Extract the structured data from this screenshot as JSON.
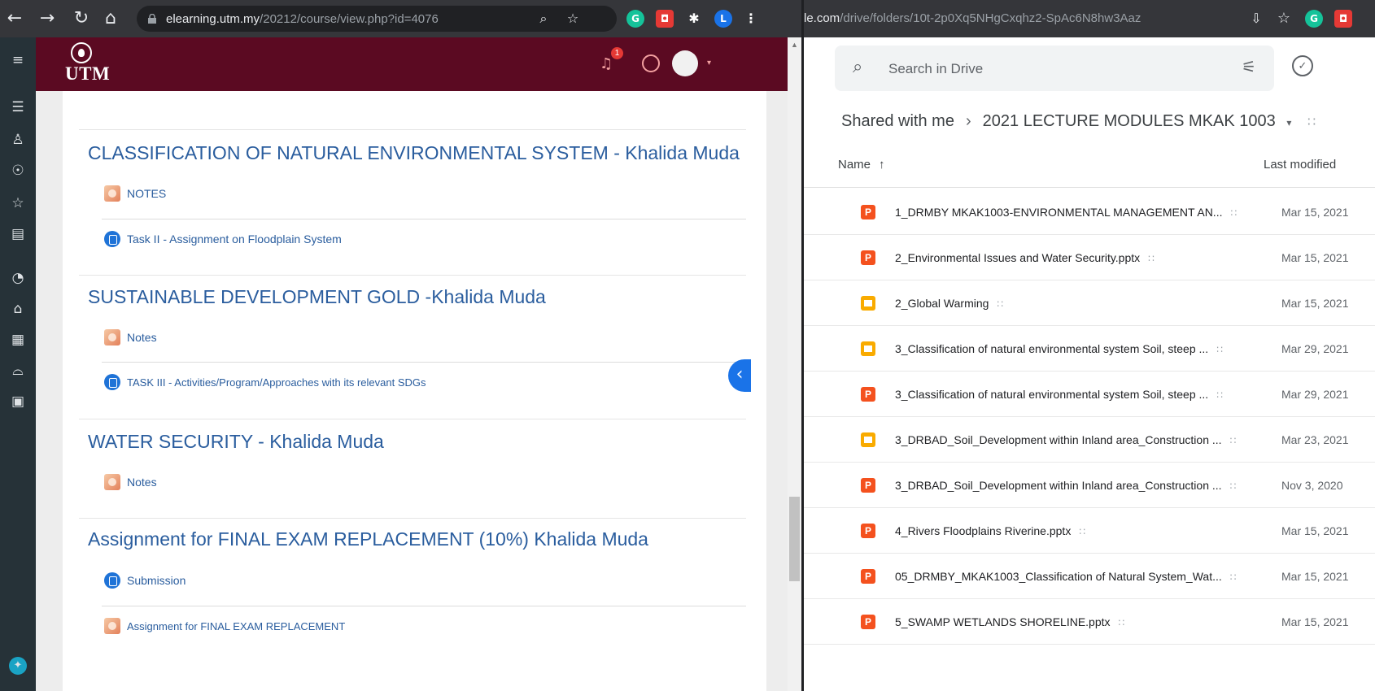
{
  "browser_left": {
    "url_host": "elearning.utm.my",
    "url_path": "/20212/course/view.php?id=4076",
    "profile_letter": "L",
    "ext_g": "G"
  },
  "browser_right": {
    "url_host": "le.com",
    "url_path": "/drive/folders/10t-2p0Xq5NHgCxqhz2-SpAc6N8hw3Aaz",
    "ext_g": "G"
  },
  "moodle": {
    "logo_text": "UTM",
    "notification_count": "1",
    "sections": [
      {
        "title": "CLASSIFICATION OF NATURAL ENVIRONMENTAL SYSTEM - Khalida Muda",
        "activities": [
          {
            "type": "resource",
            "label": "NOTES"
          },
          {
            "type": "assignment",
            "label": "Task II - Assignment on Floodplain System"
          }
        ]
      },
      {
        "title": "SUSTAINABLE DEVELOPMENT GOLD -Khalida Muda",
        "activities": [
          {
            "type": "resource",
            "label": "Notes"
          },
          {
            "type": "assignment",
            "label": "TASK III - Activities/Program/Approaches with its relevant SDGs"
          }
        ]
      },
      {
        "title": "WATER SECURITY - Khalida Muda",
        "activities": [
          {
            "type": "resource",
            "label": "Notes"
          }
        ]
      },
      {
        "title": "Assignment for FINAL EXAM REPLACEMENT (10%) Khalida Muda",
        "activities": [
          {
            "type": "assignment",
            "label": "Submission"
          },
          {
            "type": "resource",
            "label": "Assignment for FINAL EXAM REPLACEMENT"
          }
        ]
      }
    ]
  },
  "drive": {
    "search_placeholder": "Search in Drive",
    "breadcrumb_root": "Shared with me",
    "breadcrumb_folder": "2021 LECTURE MODULES MKAK 1003",
    "col_name": "Name",
    "col_modified": "Last modified",
    "files": [
      {
        "type": "pptx",
        "name": "1_DRMBY MKAK1003-ENVIRONMENTAL MANAGEMENT AN...",
        "date": "Mar 15, 2021"
      },
      {
        "type": "pptx",
        "name": "2_Environmental Issues and Water Security.pptx",
        "date": "Mar 15, 2021"
      },
      {
        "type": "slides",
        "name": "2_Global Warming",
        "date": "Mar 15, 2021"
      },
      {
        "type": "slides",
        "name": "3_Classification of natural environmental system  Soil, steep ...",
        "date": "Mar 29, 2021"
      },
      {
        "type": "pptx",
        "name": "3_Classification of natural environmental system  Soil, steep ...",
        "date": "Mar 29, 2021"
      },
      {
        "type": "slides",
        "name": "3_DRBAD_Soil_Development within Inland area_Construction ...",
        "date": "Mar 23, 2021"
      },
      {
        "type": "pptx",
        "name": "3_DRBAD_Soil_Development within Inland area_Construction ...",
        "date": "Nov 3, 2020"
      },
      {
        "type": "pptx",
        "name": "4_Rivers Floodplains Riverine.pptx",
        "date": "Mar 15, 2021"
      },
      {
        "type": "pptx",
        "name": "05_DRMBY_MKAK1003_Classification of Natural System_Wat...",
        "date": "Mar 15, 2021"
      },
      {
        "type": "pptx",
        "name": "5_SWAMP WETLANDS SHORELINE.pptx",
        "date": "Mar 15, 2021"
      }
    ]
  },
  "icons": {
    "pptx_letter": "P",
    "shared_glyph": "∷"
  },
  "colors": {
    "moodle_header": "#5b0a22",
    "link_blue": "#2a5d9e",
    "pptx_orange": "#f4511e",
    "slides_yellow": "#f9ab00"
  }
}
